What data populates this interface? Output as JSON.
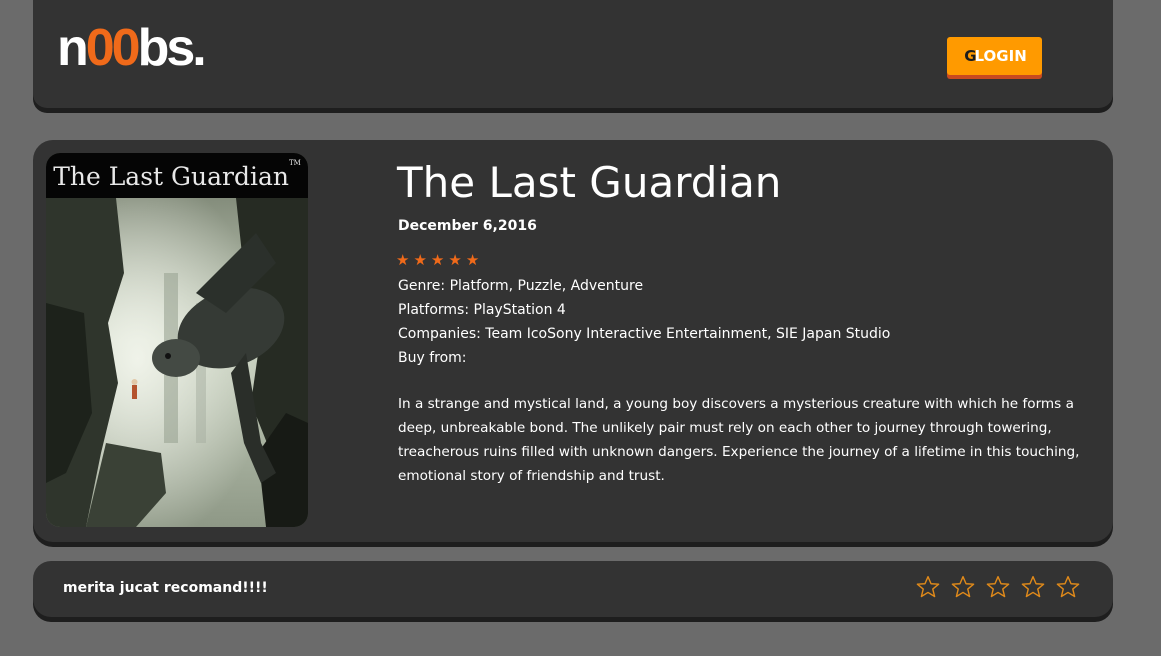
{
  "header": {
    "logo_part1": "n",
    "logo_accent": "00",
    "logo_part2": "bs.",
    "login_icon": "google-g-icon",
    "login_icon_glyph": "G",
    "login_label": "LOGIN"
  },
  "game": {
    "cover_title": "The Last Guardian",
    "cover_tm": "TM",
    "title": "The Last Guardian",
    "release_date": "December 6,2016",
    "rating_stars": 5,
    "genre": "Genre: Platform, Puzzle, Adventure",
    "platforms": "Platforms: PlayStation 4",
    "companies": "Companies: Team IcoSony Interactive Entertainment, SIE Japan Studio",
    "buy_from": "Buy from:",
    "description": "In a strange and mystical land, a young boy discovers a mysterious creature with which he forms a deep, unbreakable bond. The unlikely pair must rely on each other to journey through towering, treacherous ruins filled with unknown dangers. Experience the journey of a lifetime in this touching, emotional story of friendship and trust."
  },
  "review": {
    "text": "merita jucat recomand!!!!",
    "star_count": 5,
    "selected_stars": 0
  },
  "colors": {
    "page_bg": "#6b6b6b",
    "panel_bg": "#333333",
    "accent_orange": "#f06a1a",
    "button_orange": "#ff9a00",
    "star_outline": "#e08a1a"
  }
}
